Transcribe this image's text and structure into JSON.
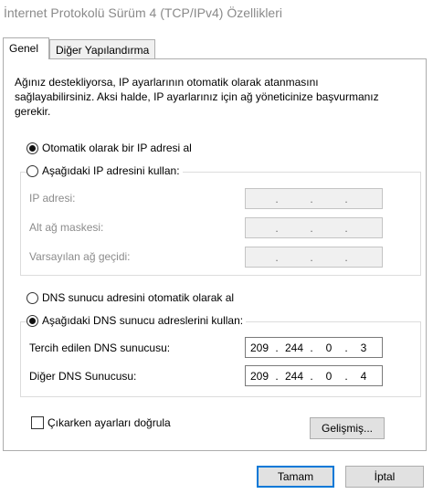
{
  "window": {
    "title": "İnternet Protokolü Sürüm 4 (TCP/IPv4) Özellikleri"
  },
  "tabs": [
    {
      "label": "Genel"
    },
    {
      "label": "Diğer Yapılandırma"
    }
  ],
  "description": "Ağınız destekliyorsa, IP ayarlarının otomatik olarak atanmasını\nsağlayabilirsiniz. Aksi halde, IP ayarlarınız için ağ yöneticinize başvurmanız\ngerekir.",
  "ip_section": {
    "auto_label": "Otomatik olarak bir IP adresi al",
    "auto_selected": true,
    "manual_label": "Aşağıdaki IP adresini kullan:",
    "manual_selected": false,
    "fields": [
      {
        "label": "IP adresi:",
        "value": [
          "",
          "",
          "",
          ""
        ]
      },
      {
        "label": "Alt ağ maskesi:",
        "value": [
          "",
          "",
          "",
          ""
        ]
      },
      {
        "label": "Varsayılan ağ geçidi:",
        "value": [
          "",
          "",
          "",
          ""
        ]
      }
    ]
  },
  "dns_section": {
    "auto_label": "DNS sunucu adresini otomatik olarak al",
    "auto_selected": false,
    "manual_label": "Aşağıdaki DNS sunucu adreslerini kullan:",
    "manual_selected": true,
    "fields": [
      {
        "label": "Tercih edilen DNS sunucusu:",
        "value": [
          "209",
          "244",
          "0",
          "3"
        ]
      },
      {
        "label": "Diğer DNS Sunucusu:",
        "value": [
          "209",
          "244",
          "0",
          "4"
        ]
      }
    ]
  },
  "validate_checkbox": {
    "label": "Çıkarken ayarları doğrula",
    "checked": false
  },
  "buttons": {
    "advanced": "Gelişmiş...",
    "ok": "Tamam",
    "cancel": "İptal"
  },
  "colors": {
    "accent": "#0078d7",
    "disabled_text": "#8c8c8c"
  }
}
